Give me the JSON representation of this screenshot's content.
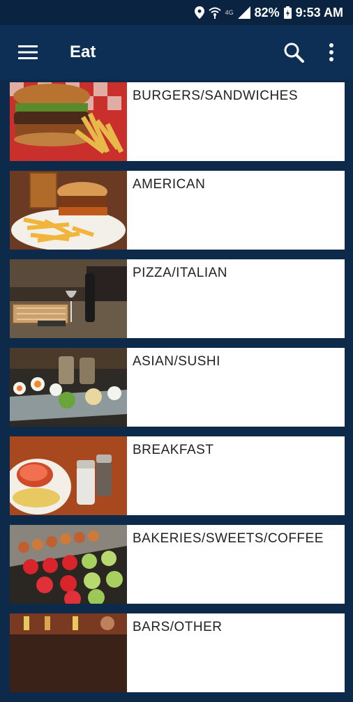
{
  "status": {
    "battery": "82%",
    "time": "9:53 AM",
    "network": "4G"
  },
  "appbar": {
    "title": "Eat",
    "menu_icon": "hamburger-menu-icon",
    "search_icon": "search-icon",
    "more_icon": "more-vert-icon"
  },
  "categories": [
    {
      "label": "BURGERS/SANDWICHES",
      "image": "burger-with-fries-photo"
    },
    {
      "label": "AMERICAN",
      "image": "burger-plate-photo"
    },
    {
      "label": "PIZZA/ITALIAN",
      "image": "pizza-and-wine-photo"
    },
    {
      "label": "ASIAN/SUSHI",
      "image": "sushi-platter-photo"
    },
    {
      "label": "BREAKFAST",
      "image": "breakfast-omelet-photo"
    },
    {
      "label": "BAKERIES/SWEETS/COFFEE",
      "image": "pastry-display-photo"
    },
    {
      "label": "BARS/OTHER",
      "image": "bar-photo"
    }
  ]
}
